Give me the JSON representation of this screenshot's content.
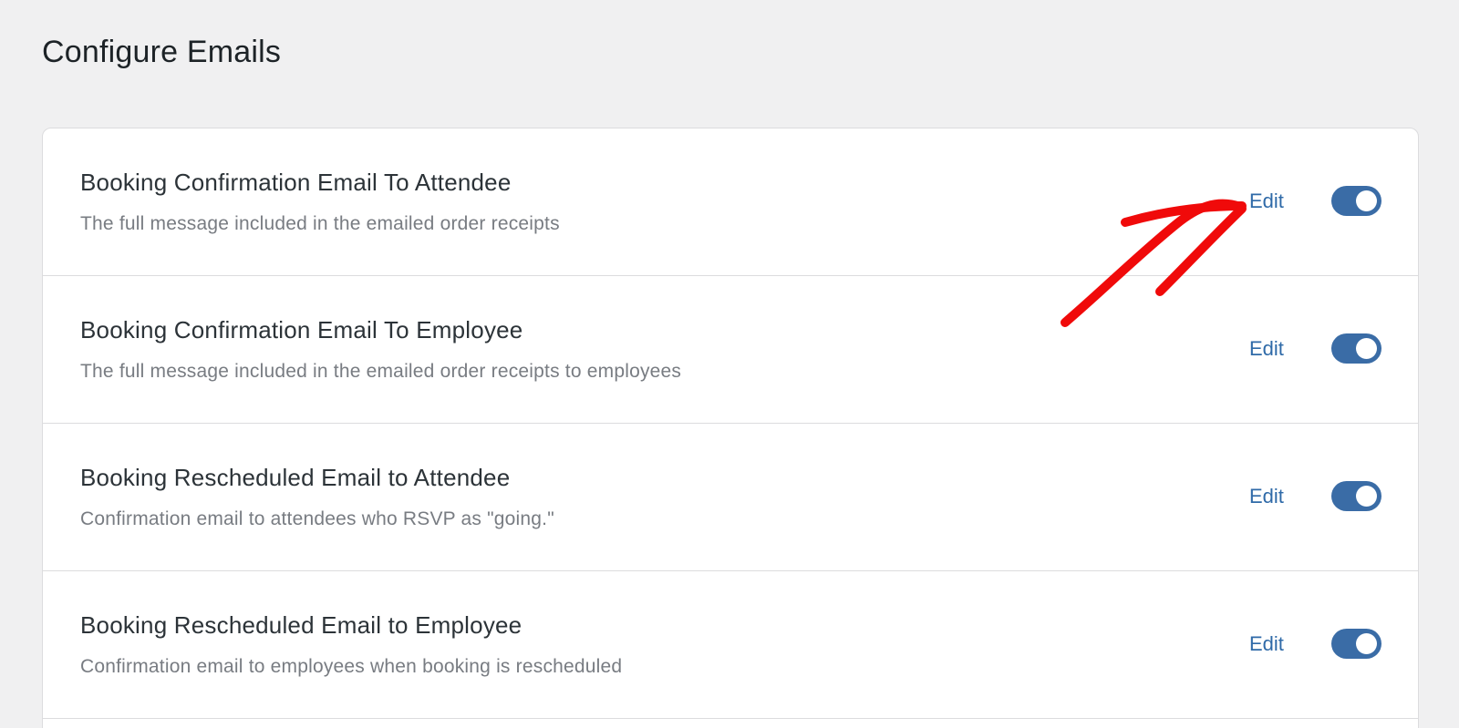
{
  "page": {
    "title": "Configure Emails"
  },
  "emails": [
    {
      "title": "Booking Confirmation Email To Attendee",
      "description": "The full message included in the emailed order receipts",
      "edit_label": "Edit",
      "enabled": true
    },
    {
      "title": "Booking Confirmation Email To Employee",
      "description": "The full message included in the emailed order receipts to employees",
      "edit_label": "Edit",
      "enabled": true
    },
    {
      "title": "Booking Rescheduled Email to Attendee",
      "description": "Confirmation email to attendees who RSVP as \"going.\"",
      "edit_label": "Edit",
      "enabled": true
    },
    {
      "title": "Booking Rescheduled Email to Employee",
      "description": "Confirmation email to employees when booking is rescheduled",
      "edit_label": "Edit",
      "enabled": true
    }
  ],
  "colors": {
    "accent": "#2f6aa8",
    "toggle_on": "#3a6ca6",
    "annotation": "#f00a0a",
    "background": "#f0f0f1"
  },
  "annotation": {
    "icon": "red-arrow-icon"
  }
}
